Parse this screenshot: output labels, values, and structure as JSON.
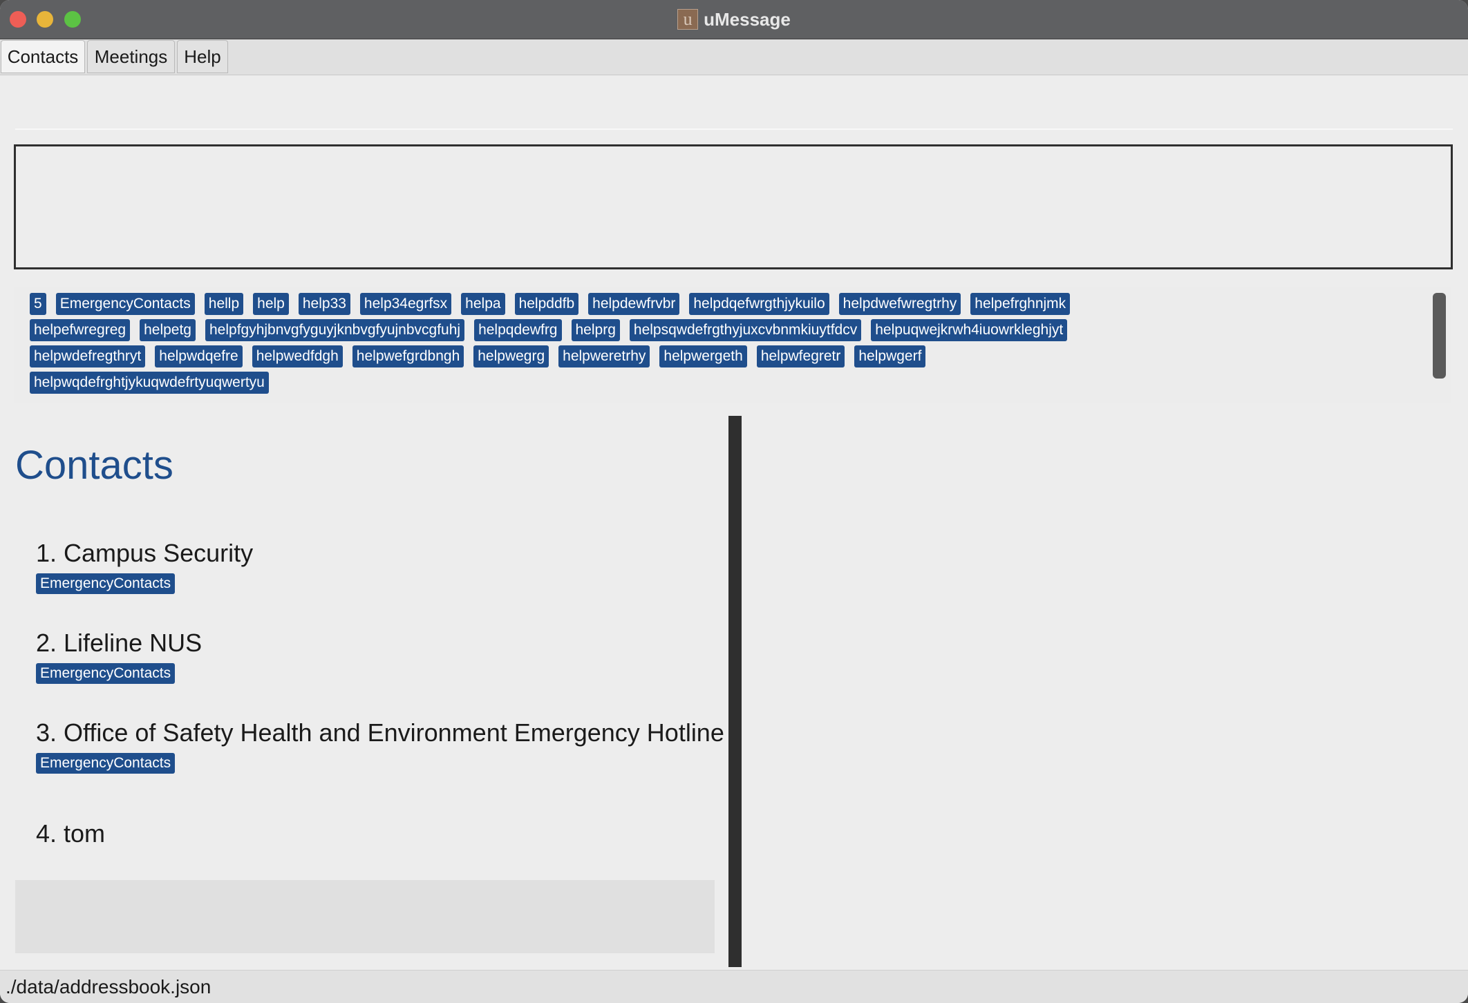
{
  "window": {
    "title": "uMessage",
    "icon_letter": "u"
  },
  "menu": {
    "contacts": "Contacts",
    "meetings": "Meetings",
    "help": "Help"
  },
  "tags": [
    "5",
    "EmergencyContacts",
    "hellp",
    "help",
    "help33",
    "help34egrfsx",
    "helpa",
    "helpddfb",
    "helpdewfrvbr",
    "helpdqefwrgthjykuilo",
    "helpdwefwregtrhy",
    "helpefrghnjmk",
    "helpefwregreg",
    "helpetg",
    "helpfgyhjbnvgfyguyjknbvgfyujnbvcgfuhj",
    "helpqdewfrg",
    "helprg",
    "helpsqwdefrgthyjuxcvbnmkiuytfdcv",
    "helpuqwejkrwh4iuowrkleghjyt",
    "helpwdefregthryt",
    "helpwdqefre",
    "helpwedfdgh",
    "helpwefgrdbngh",
    "helpwegrg",
    "helpweretrhy",
    "helpwergeth",
    "helpwfegretr",
    "helpwgerf",
    "helpwqdefrghtjykuqwdefrtyuqwertyu"
  ],
  "contacts": {
    "title": "Contacts",
    "items": [
      {
        "name": "1.  Campus Security",
        "tag": "EmergencyContacts"
      },
      {
        "name": "2.  Lifeline NUS",
        "tag": "EmergencyContacts"
      },
      {
        "name": "3.  Office of Safety Health and Environment Emergency Hotline",
        "tag": "EmergencyContacts"
      },
      {
        "name": "4.  tom",
        "tag": ""
      }
    ]
  },
  "status": {
    "path": "./data/addressbook.json"
  },
  "colors": {
    "accent": "#1f4e8c",
    "close": "#ee5e56",
    "minimize": "#e8b53a",
    "maximize": "#5cc244"
  }
}
